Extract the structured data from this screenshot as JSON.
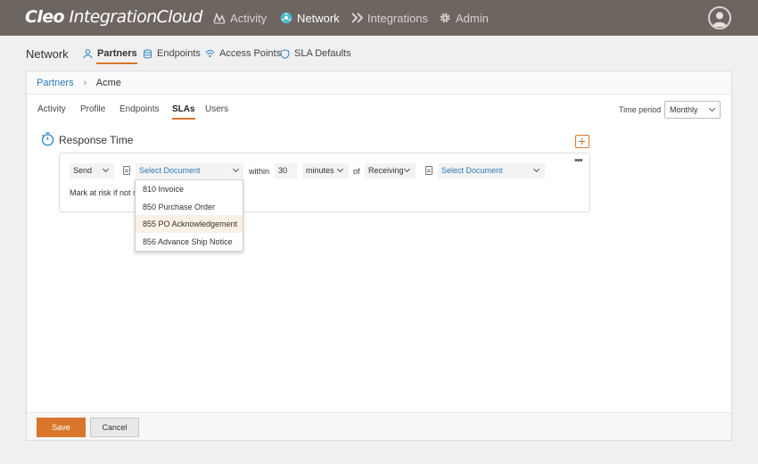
{
  "app": {
    "logo_bold": "Cleo",
    "logo_light": " IntegrationCloud"
  },
  "topnav": {
    "items": [
      {
        "label": "Activity",
        "icon": "activity-icon"
      },
      {
        "label": "Network",
        "icon": "network-icon",
        "active": true
      },
      {
        "label": "Integrations",
        "icon": "integrations-icon"
      },
      {
        "label": "Admin",
        "icon": "gear-icon"
      }
    ]
  },
  "subnav": {
    "title": "Network",
    "tabs": [
      {
        "label": "Partners",
        "icon": "partners-icon",
        "active": true
      },
      {
        "label": "Endpoints",
        "icon": "endpoints-icon"
      },
      {
        "label": "Access Points",
        "icon": "access-points-icon"
      },
      {
        "label": "SLA Defaults",
        "icon": "sla-defaults-icon"
      }
    ]
  },
  "breadcrumb": {
    "parent": "Partners",
    "current": "Acme"
  },
  "inner_tabs": [
    {
      "label": "Activity"
    },
    {
      "label": "Profile"
    },
    {
      "label": "Endpoints"
    },
    {
      "label": "SLAs",
      "active": true
    },
    {
      "label": "Users"
    }
  ],
  "time_period": {
    "label": "Time period",
    "value": "Monthly"
  },
  "section": {
    "title": "Response Time"
  },
  "rule": {
    "direction": "Send",
    "document_placeholder": "Select Document",
    "within_label": "within",
    "amount": "30",
    "unit": "minutes",
    "of_label": "of",
    "event": "Receiving",
    "document2_placeholder": "Select Document",
    "at_risk_text": "Mark at risk if not se"
  },
  "dropdown": {
    "options": [
      "810 Invoice",
      "850 Purchase Order",
      "855 PO Acknowledgement",
      "856 Advance Ship Notice"
    ],
    "highlighted_index": 2
  },
  "footer": {
    "save_label": "Save",
    "cancel_label": "Cancel"
  },
  "colors": {
    "topbar": "#6d6560",
    "accent": "#d9762c",
    "link": "#2d7ab5"
  }
}
